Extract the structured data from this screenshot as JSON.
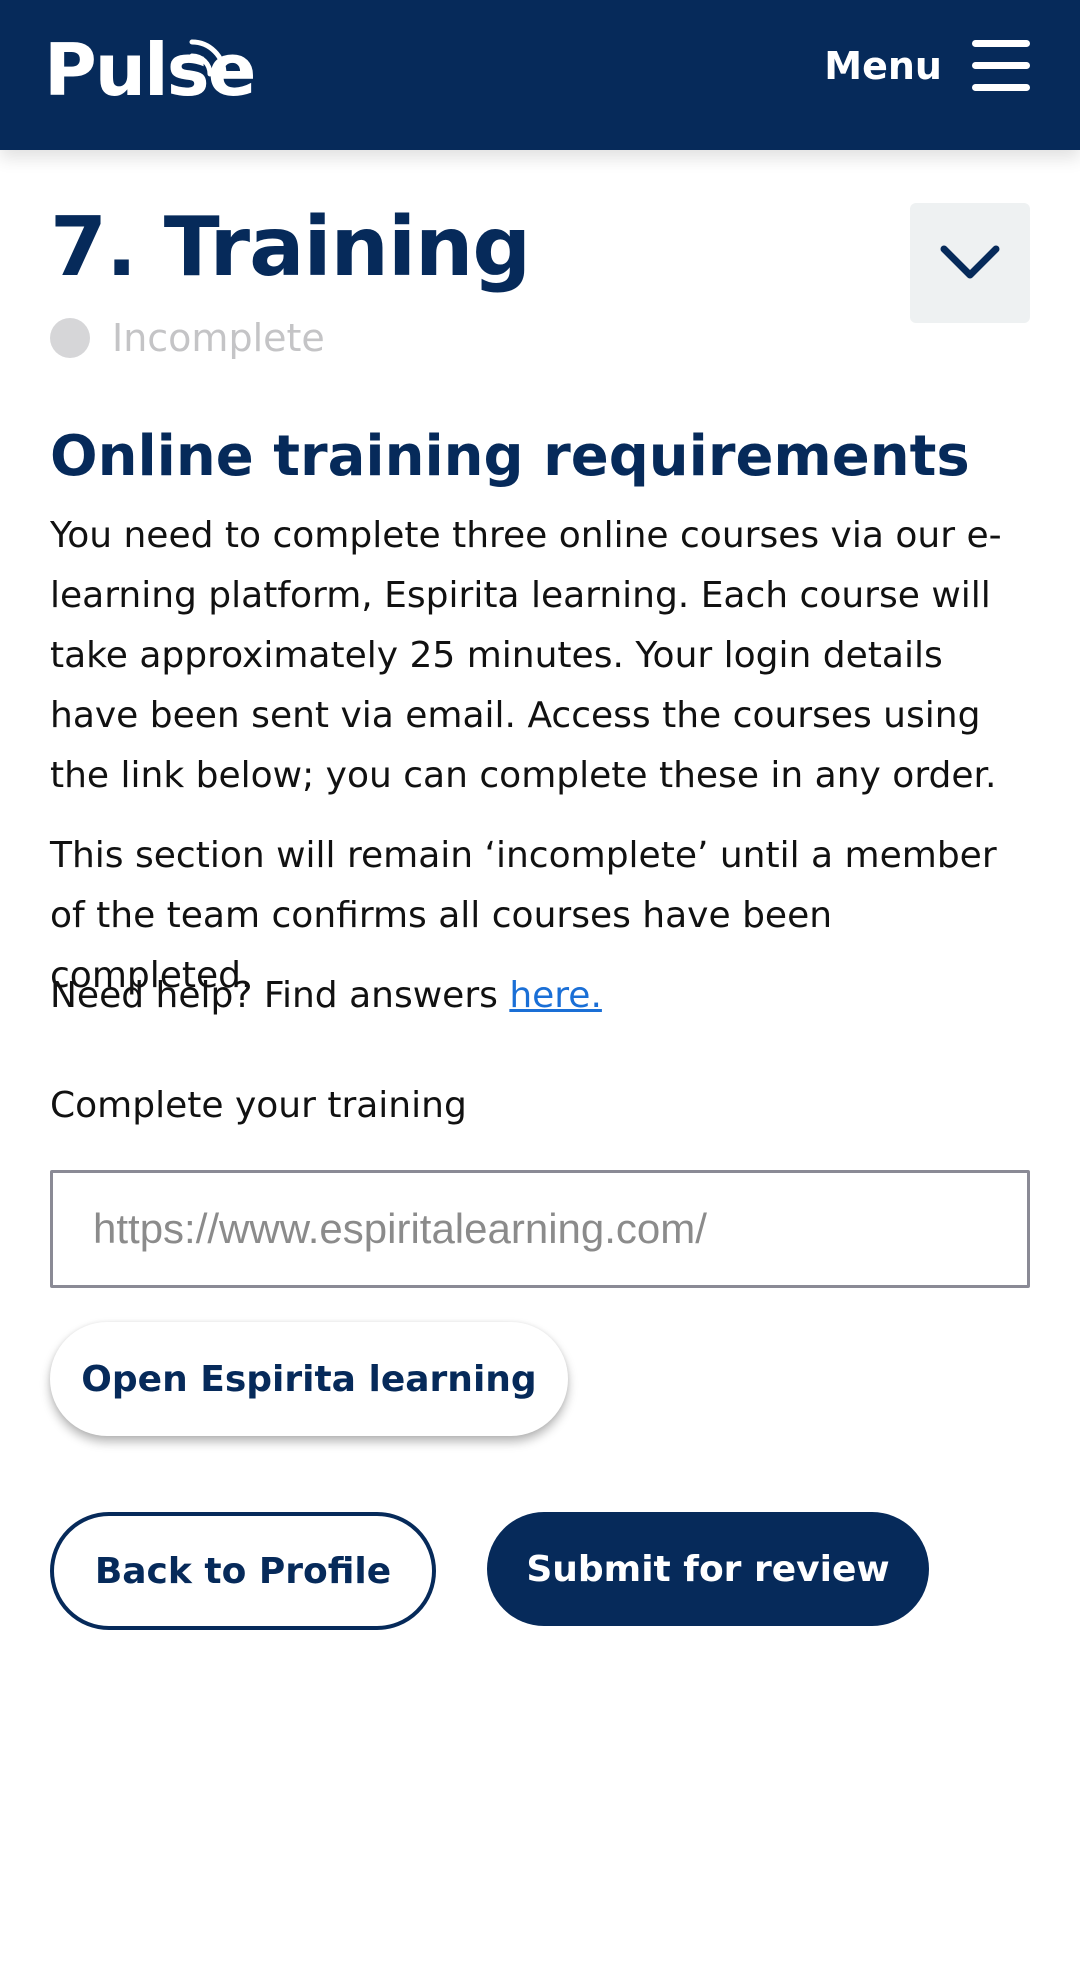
{
  "header": {
    "logo_text": "Pulse",
    "menu_label": "Menu"
  },
  "section": {
    "title": "7. Training",
    "status": "Incomplete"
  },
  "content": {
    "heading": "Online training requirements",
    "paragraph_1": "You need to complete three online courses via our e-learning platform, Espirita learning. Each course will take approximately 25 minutes. Your login details have been sent via email. Access the courses using the link below; you can complete these in any order.",
    "paragraph_2": "This section will remain ‘incomplete’ until a member of the team confirms all courses have been completed.",
    "help_prefix": "Need help? Find answers ",
    "help_link": "here."
  },
  "training": {
    "label": "Complete your training",
    "url_placeholder": "https://www.espiritalearning.com/",
    "open_button": "Open Espirita learning"
  },
  "actions": {
    "back_button": "Back to Profile",
    "submit_button": "Submit for review"
  },
  "colors": {
    "brand_navy": "#062a5a",
    "link_blue": "#1a6fd6",
    "status_grey": "#d6d6d8"
  }
}
